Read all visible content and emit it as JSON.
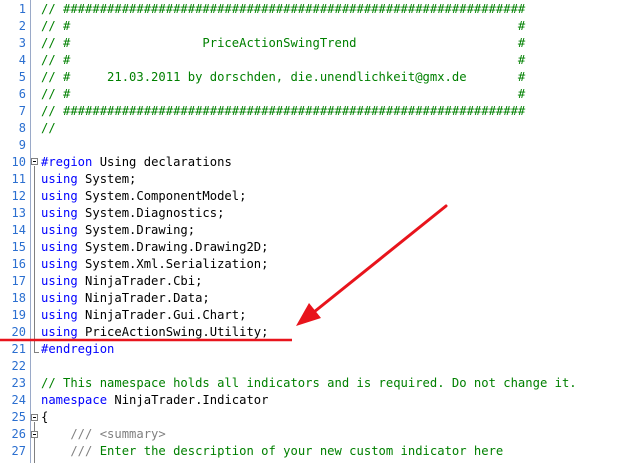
{
  "lines": [
    {
      "n": "1",
      "parts": [
        {
          "c": "cm",
          "t": "// ###############################################################"
        }
      ]
    },
    {
      "n": "2",
      "parts": [
        {
          "c": "cm",
          "t": "// #                                                             #"
        }
      ]
    },
    {
      "n": "3",
      "parts": [
        {
          "c": "cm",
          "t": "// #                  PriceActionSwingTrend                      #"
        }
      ]
    },
    {
      "n": "4",
      "parts": [
        {
          "c": "cm",
          "t": "// #                                                             #"
        }
      ]
    },
    {
      "n": "5",
      "parts": [
        {
          "c": "cm",
          "t": "// #     21.03.2011 by dorschden, die.unendlichkeit@gmx.de       #"
        }
      ]
    },
    {
      "n": "6",
      "parts": [
        {
          "c": "cm",
          "t": "// #                                                             #"
        }
      ]
    },
    {
      "n": "7",
      "parts": [
        {
          "c": "cm",
          "t": "// ###############################################################"
        }
      ]
    },
    {
      "n": "8",
      "parts": [
        {
          "c": "cm",
          "t": "//"
        }
      ]
    },
    {
      "n": "9",
      "parts": []
    },
    {
      "n": "10",
      "parts": [
        {
          "c": "kw",
          "t": "#region"
        },
        {
          "c": "tx",
          "t": " Using declarations"
        }
      ]
    },
    {
      "n": "11",
      "parts": [
        {
          "c": "kw",
          "t": "using"
        },
        {
          "c": "tx",
          "t": " System;"
        }
      ]
    },
    {
      "n": "12",
      "parts": [
        {
          "c": "kw",
          "t": "using"
        },
        {
          "c": "tx",
          "t": " System.ComponentModel;"
        }
      ]
    },
    {
      "n": "13",
      "parts": [
        {
          "c": "kw",
          "t": "using"
        },
        {
          "c": "tx",
          "t": " System.Diagnostics;"
        }
      ]
    },
    {
      "n": "14",
      "parts": [
        {
          "c": "kw",
          "t": "using"
        },
        {
          "c": "tx",
          "t": " System.Drawing;"
        }
      ]
    },
    {
      "n": "15",
      "parts": [
        {
          "c": "kw",
          "t": "using"
        },
        {
          "c": "tx",
          "t": " System.Drawing.Drawing2D;"
        }
      ]
    },
    {
      "n": "16",
      "parts": [
        {
          "c": "kw",
          "t": "using"
        },
        {
          "c": "tx",
          "t": " System.Xml.Serialization;"
        }
      ]
    },
    {
      "n": "17",
      "parts": [
        {
          "c": "kw",
          "t": "using"
        },
        {
          "c": "tx",
          "t": " NinjaTrader.Cbi;"
        }
      ]
    },
    {
      "n": "18",
      "parts": [
        {
          "c": "kw",
          "t": "using"
        },
        {
          "c": "tx",
          "t": " NinjaTrader.Data;"
        }
      ]
    },
    {
      "n": "19",
      "parts": [
        {
          "c": "kw",
          "t": "using"
        },
        {
          "c": "tx",
          "t": " NinjaTrader.Gui.Chart;"
        }
      ]
    },
    {
      "n": "20",
      "parts": [
        {
          "c": "kw",
          "t": "using"
        },
        {
          "c": "tx",
          "t": " PriceActionSwing.Utility;"
        }
      ]
    },
    {
      "n": "21",
      "parts": [
        {
          "c": "kw",
          "t": "#endregion"
        }
      ]
    },
    {
      "n": "22",
      "parts": []
    },
    {
      "n": "23",
      "parts": [
        {
          "c": "cm",
          "t": "// This namespace holds all indicators and is required. Do not change it."
        }
      ]
    },
    {
      "n": "24",
      "parts": [
        {
          "c": "kw",
          "t": "namespace"
        },
        {
          "c": "tx",
          "t": " NinjaTrader.Indicator"
        }
      ]
    },
    {
      "n": "25",
      "parts": [
        {
          "c": "tx",
          "t": "{"
        }
      ]
    },
    {
      "n": "26",
      "parts": [
        {
          "c": "doc",
          "t": "    /// <summary>"
        }
      ]
    },
    {
      "n": "27",
      "parts": [
        {
          "c": "doc",
          "t": "    /// "
        },
        {
          "c": "cm",
          "t": "Enter the description of your new custom indicator here"
        }
      ]
    }
  ],
  "colors": {
    "annotation": "#e8141c",
    "line_number": "#2b6fd0",
    "comment": "#008000",
    "keyword": "#0000ff"
  }
}
